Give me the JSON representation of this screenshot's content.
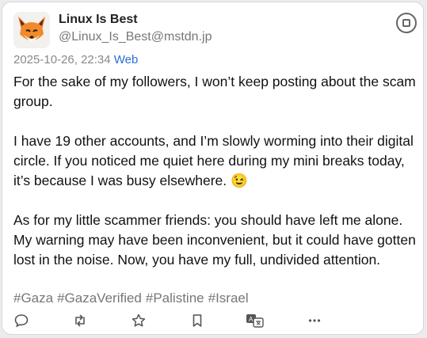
{
  "post": {
    "display_name": "Linux Is Best",
    "handle": "@Linux_Is_Best@mstdn.jp",
    "timestamp": "2025-10-26, 22:34",
    "via": "Web",
    "paragraphs": [
      "For the sake of my followers, I won’t keep posting about the scam group.",
      "I have 19 other accounts, and I’m slowly worming into their digital circle. If you noticed me quiet here during my mini breaks today, it’s because I was busy elsewhere. 😉",
      "As for my little scammer friends: you should have left me alone. My warning may have been inconvenient, but it could have gotten lost in the noise. Now, you have my full, undivided attention."
    ],
    "hashtags": [
      "#Gaza",
      "#GazaVerified",
      "#Palistine",
      "#Israel"
    ]
  },
  "icons": {
    "avatar": "fox-avatar",
    "menu": "circle-menu-icon",
    "reply": "reply-icon",
    "boost": "boost-icon",
    "favourite": "star-icon",
    "bookmark": "bookmark-icon",
    "translate": "translate-icon",
    "more": "more-icon"
  },
  "colors": {
    "link": "#2b6fd6",
    "muted": "#777777",
    "text": "#111111"
  }
}
